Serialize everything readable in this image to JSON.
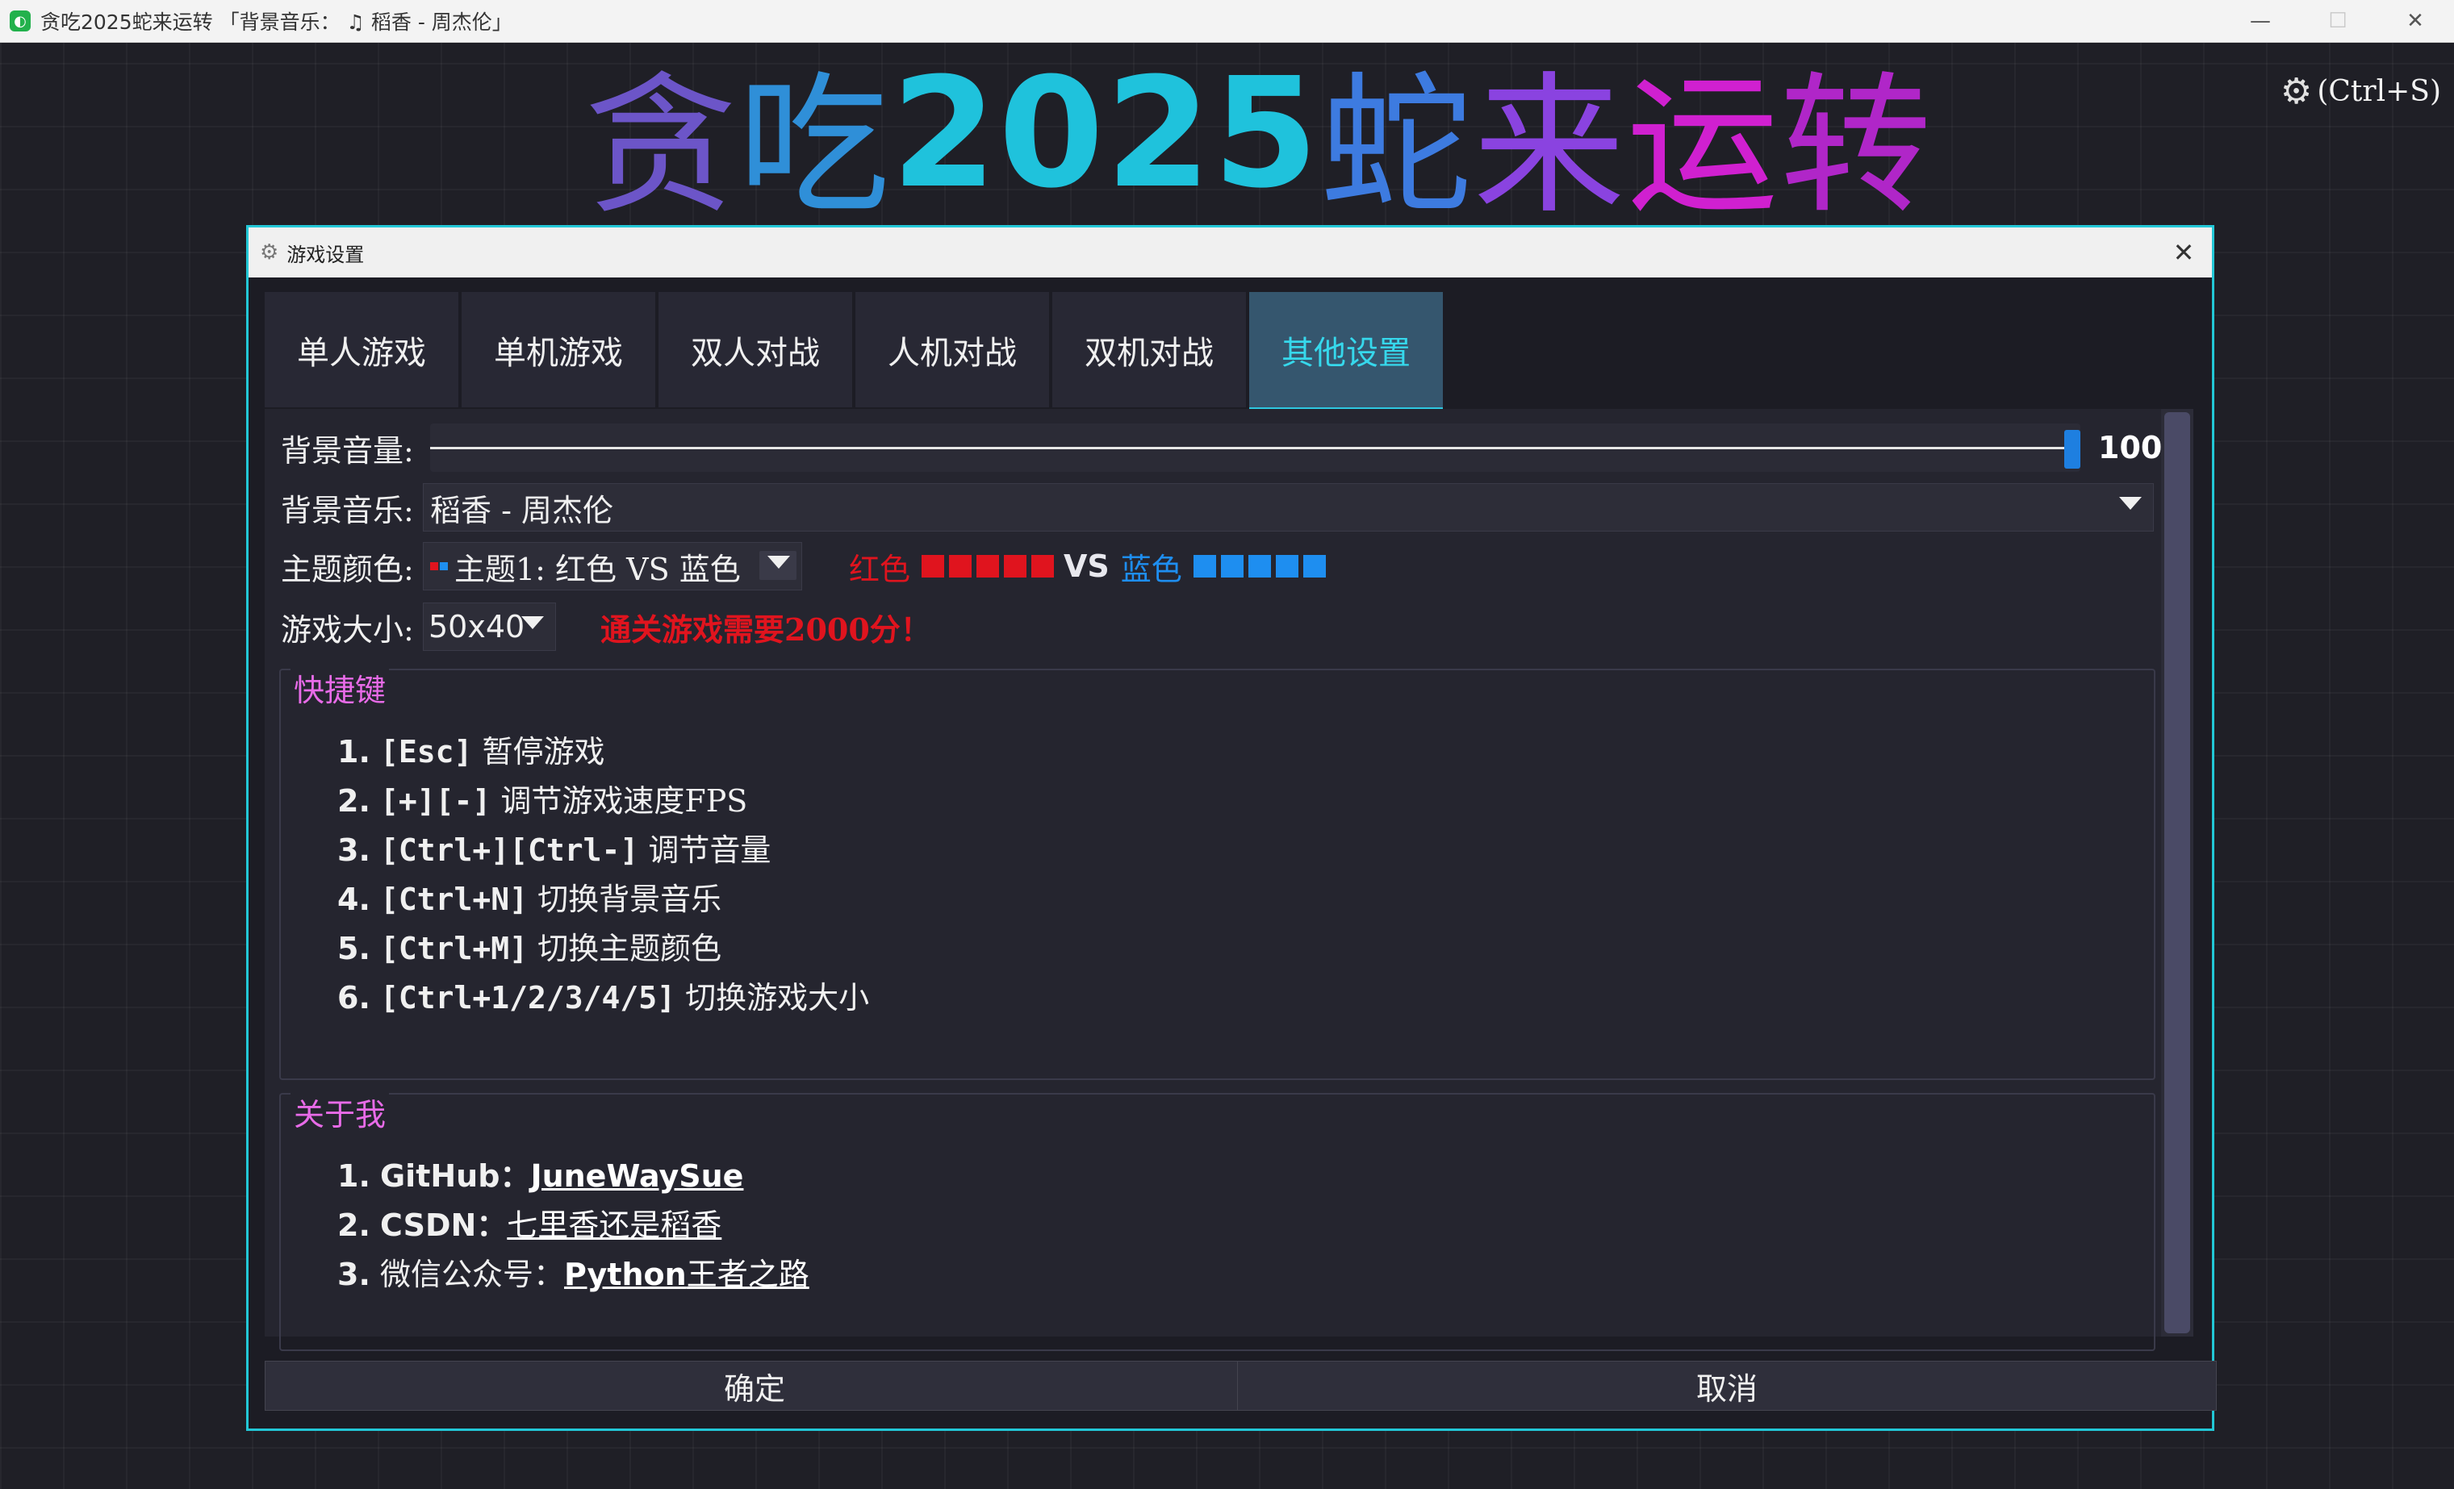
{
  "window": {
    "title": "贪吃2025蛇来运转 「背景音乐： ♫ 稻香 - 周杰伦」",
    "icon": "app-icon",
    "controls": [
      "minimize",
      "maximize",
      "close"
    ]
  },
  "banner": {
    "parts": [
      "贪",
      "吃",
      "2025",
      "蛇",
      "来",
      "运",
      "转"
    ]
  },
  "settings_hint": "(Ctrl+S)",
  "dialog": {
    "title": "游戏设置",
    "tabs": [
      {
        "label": "单人游戏",
        "active": false
      },
      {
        "label": "单机游戏",
        "active": false
      },
      {
        "label": "双人对战",
        "active": false
      },
      {
        "label": "人机对战",
        "active": false
      },
      {
        "label": "双机对战",
        "active": false
      },
      {
        "label": "其他设置",
        "active": true
      }
    ],
    "volume": {
      "label": "背景音量:",
      "value": 100,
      "value_text": "100",
      "max": 100
    },
    "music": {
      "label": "背景音乐:",
      "selected": "稻香 - 周杰伦"
    },
    "theme": {
      "label": "主题颜色:",
      "selected": "主题1: 红色 VS 蓝色",
      "preview": {
        "left_name": "红色",
        "vs": "VS",
        "right_name": "蓝色",
        "left_color": "#e0141e",
        "right_color": "#1e8ef0",
        "squares": 5
      }
    },
    "size": {
      "label": "游戏大小:",
      "selected": "50x40",
      "win_message": "通关游戏需要2000分！"
    },
    "shortcuts": {
      "title": "快捷键",
      "items": [
        {
          "num": "1.",
          "key": "[Esc]",
          "desc": " 暂停游戏"
        },
        {
          "num": "2.",
          "key": "[+][-]",
          "desc": " 调节游戏速度FPS"
        },
        {
          "num": "3.",
          "key": "[Ctrl+][Ctrl-]",
          "desc": " 调节音量"
        },
        {
          "num": "4.",
          "key": "[Ctrl+N]",
          "desc": " 切换背景音乐"
        },
        {
          "num": "5.",
          "key": "[Ctrl+M]",
          "desc": " 切换主题颜色"
        },
        {
          "num": "6.",
          "key": "[Ctrl+1/2/3/4/5]",
          "desc": " 切换游戏大小"
        }
      ]
    },
    "about": {
      "title": "关于我",
      "items": [
        {
          "num": "1.",
          "label": "GitHub：",
          "link": "JuneWaySue"
        },
        {
          "num": "2.",
          "label": "CSDN：",
          "link": "七里香还是稻香"
        },
        {
          "num": "3.",
          "label": "微信公众号：",
          "link_a": "Python",
          "link_b": "王者之路"
        }
      ]
    },
    "ok_label": "确定",
    "cancel_label": "取消"
  },
  "colors": {
    "accent": "#22c7d6",
    "tab_active_bg": "#35566e",
    "tab_active_text": "#36d8ec",
    "group_title": "#e86be8",
    "warning_red": "#e0141e",
    "slider_handle": "#1e7fe0"
  }
}
